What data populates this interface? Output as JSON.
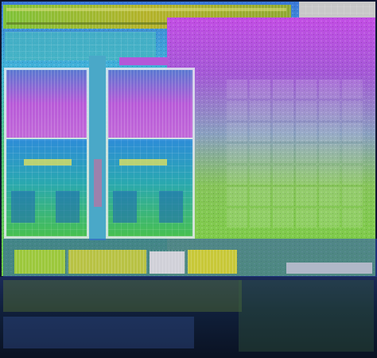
{
  "image": {
    "subject": "die-shot",
    "palette": {
      "top_band": "#a8b020",
      "purple": "#a048d8",
      "magenta": "#d050e0",
      "cyan": "#30c8d8",
      "green": "#70c850",
      "lime": "#b8e048",
      "yellow_green": "#c8d040",
      "blue_edge": "#2a4fb8",
      "dark_reflection": "#101830"
    },
    "core_blocks": [
      "left-cpu-module",
      "right-cpu-module"
    ],
    "gpu_region": "gpu-array"
  }
}
